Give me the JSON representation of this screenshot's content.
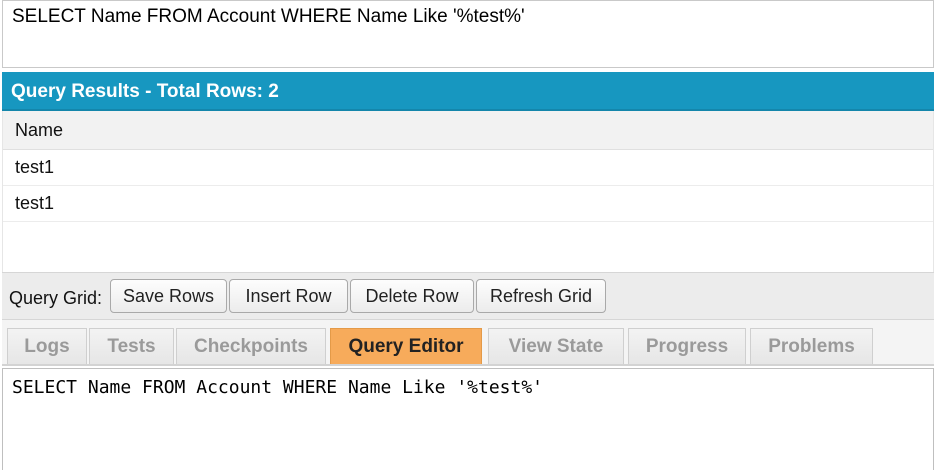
{
  "top_query": {
    "text": "SELECT Name FROM Account WHERE Name Like '%test%'"
  },
  "results": {
    "title": "Query Results - Total Rows: 2",
    "column": "Name",
    "rows": [
      "test1",
      "test1"
    ]
  },
  "toolbar": {
    "label": "Query Grid:",
    "save_rows": "Save Rows",
    "insert_row": "Insert Row",
    "delete_row": "Delete Row",
    "refresh_grid": "Refresh Grid"
  },
  "tabs": [
    {
      "label": "Logs",
      "active": false
    },
    {
      "label": "Tests",
      "active": false
    },
    {
      "label": "Checkpoints",
      "active": false
    },
    {
      "label": "Query Editor",
      "active": true
    },
    {
      "label": "View State",
      "active": false
    },
    {
      "label": "Progress",
      "active": false
    },
    {
      "label": "Problems",
      "active": false
    }
  ],
  "editor": {
    "text": "SELECT Name FROM Account WHERE Name Like '%test%'"
  },
  "colors": {
    "header": "#1797c0",
    "active_tab": "#f7ab5b"
  }
}
